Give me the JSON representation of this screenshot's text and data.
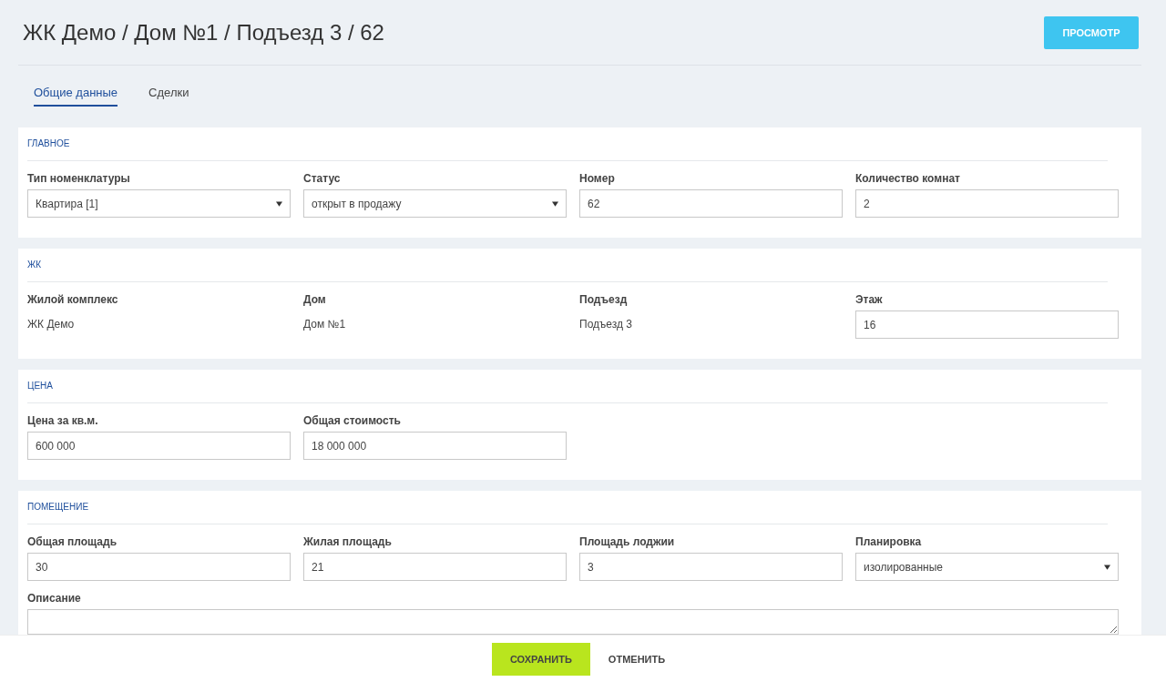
{
  "header": {
    "title": "ЖК Демо / Дом №1 / Подъезд 3 / 62",
    "view_button": "ПРОСМОТР"
  },
  "tabs": [
    {
      "label": "Общие данные",
      "selected": true
    },
    {
      "label": "Сделки",
      "selected": false
    }
  ],
  "sections": [
    {
      "title": "ГЛАВНОЕ",
      "fields": [
        {
          "label": "Тип номенклатуры",
          "kind": "select",
          "value": "Квартира [1]"
        },
        {
          "label": "Статус",
          "kind": "select",
          "value": "открыт в продажу"
        },
        {
          "label": "Номер",
          "kind": "input",
          "value": "62"
        },
        {
          "label": "Количество комнат",
          "kind": "input",
          "value": "2"
        }
      ]
    },
    {
      "title": "ЖК",
      "fields": [
        {
          "label": "Жилой комплекс",
          "kind": "text",
          "value": "ЖК Демо"
        },
        {
          "label": "Дом",
          "kind": "text",
          "value": "Дом №1"
        },
        {
          "label": "Подъезд",
          "kind": "text",
          "value": "Подъезд 3"
        },
        {
          "label": "Этаж",
          "kind": "input",
          "value": "16"
        }
      ]
    },
    {
      "title": "ЦЕНА",
      "fields": [
        {
          "label": "Цена за кв.м.",
          "kind": "input",
          "value": "600 000"
        },
        {
          "label": "Общая стоимость",
          "kind": "input",
          "value": "18 000 000"
        }
      ]
    },
    {
      "title": "ПОМЕЩЕНИЕ",
      "fields": [
        {
          "label": "Общая площадь",
          "kind": "input",
          "value": "30"
        },
        {
          "label": "Жилая площадь",
          "kind": "input",
          "value": "21"
        },
        {
          "label": "Площадь лоджии",
          "kind": "input",
          "value": "3"
        },
        {
          "label": "Планировка",
          "kind": "select",
          "value": "изолированные"
        },
        {
          "label": "Описание",
          "kind": "textarea"
        }
      ]
    }
  ],
  "footer": {
    "save": "СОХРАНИТЬ",
    "cancel": "ОТМЕНИТЬ"
  }
}
